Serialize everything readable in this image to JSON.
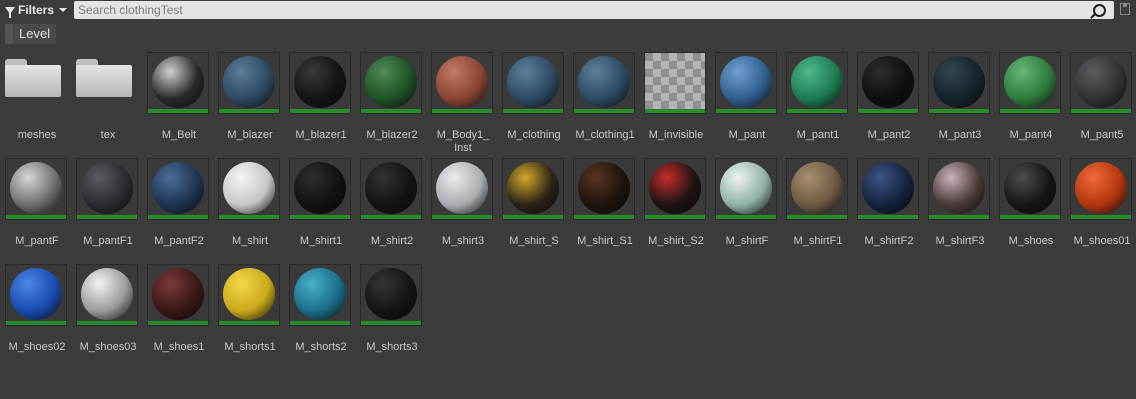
{
  "toolbar": {
    "filters_label": "Filters",
    "search_placeholder": "Search clothingTest"
  },
  "chips": {
    "level_label": "Level"
  },
  "assets": [
    {
      "label": "meshes",
      "kind": "folder"
    },
    {
      "label": "tex",
      "kind": "folder"
    },
    {
      "label": "M_Belt",
      "kind": "material",
      "color": "#2a2a2a",
      "highlight": "#cfcfcf"
    },
    {
      "label": "M_blazer",
      "kind": "material",
      "color": "#2e4a63",
      "highlight": "#5d7d98"
    },
    {
      "label": "M_blazer1",
      "kind": "material",
      "color": "#141414",
      "highlight": "#3a3a3a"
    },
    {
      "label": "M_blazer2",
      "kind": "material",
      "color": "#1f5226",
      "highlight": "#4f8a55"
    },
    {
      "label": "M_Body1_\nInst",
      "kind": "material",
      "color": "#8a4434",
      "highlight": "#c07a66"
    },
    {
      "label": "M_clothing",
      "kind": "material",
      "color": "#2d4a63",
      "highlight": "#5e7f9c"
    },
    {
      "label": "M_clothing1",
      "kind": "material",
      "color": "#2d4a63",
      "highlight": "#5e7f9c"
    },
    {
      "label": "M_invisible",
      "kind": "checker"
    },
    {
      "label": "M_pant",
      "kind": "material",
      "color": "#2f5f8e",
      "highlight": "#6f9fd0"
    },
    {
      "label": "M_pant1",
      "kind": "material",
      "color": "#1c7a55",
      "highlight": "#4fb88c"
    },
    {
      "label": "M_pant2",
      "kind": "material",
      "color": "#0f0f0f",
      "highlight": "#2e2e2e"
    },
    {
      "label": "M_pant3",
      "kind": "material",
      "color": "#15232b",
      "highlight": "#34464f"
    },
    {
      "label": "M_pant4",
      "kind": "material",
      "color": "#2f7a3e",
      "highlight": "#68b677"
    },
    {
      "label": "M_pant5",
      "kind": "material",
      "color": "#303234",
      "highlight": "#5b5e61"
    },
    {
      "label": "M_pantF",
      "kind": "material",
      "color": "#6e6e6e",
      "highlight": "#d6d6d6"
    },
    {
      "label": "M_pantF1",
      "kind": "material",
      "color": "#2a2c30",
      "highlight": "#5a5d63"
    },
    {
      "label": "M_pantF2",
      "kind": "material",
      "color": "#1e3452",
      "highlight": "#4d6e99"
    },
    {
      "label": "M_shirt",
      "kind": "material",
      "color": "#c6c6c6",
      "highlight": "#f4f4f4"
    },
    {
      "label": "M_shirt1",
      "kind": "material",
      "color": "#111111",
      "highlight": "#2f2f2f"
    },
    {
      "label": "M_shirt2",
      "kind": "material",
      "color": "#131313",
      "highlight": "#333333"
    },
    {
      "label": "M_shirt3",
      "kind": "material",
      "color": "#a9adb0",
      "highlight": "#e8eaec"
    },
    {
      "label": "M_shirt_S",
      "kind": "material",
      "color": "#2a2418",
      "highlight": "#d4a72a"
    },
    {
      "label": "M_shirt_S1",
      "kind": "material",
      "color": "#1e140e",
      "highlight": "#5a3522"
    },
    {
      "label": "M_shirt_S2",
      "kind": "material",
      "color": "#1c1414",
      "highlight": "#c52c2c"
    },
    {
      "label": "M_shirtF",
      "kind": "material",
      "color": "#8fb0a8",
      "highlight": "#eef3ee"
    },
    {
      "label": "M_shirtF1",
      "kind": "material",
      "color": "#6e5a43",
      "highlight": "#a88e6e"
    },
    {
      "label": "M_shirtF2",
      "kind": "material",
      "color": "#14233f",
      "highlight": "#3d5585"
    },
    {
      "label": "M_shirtF3",
      "kind": "material",
      "color": "#4a3a3a",
      "highlight": "#c9b2b6"
    },
    {
      "label": "M_shoes",
      "kind": "material",
      "color": "#161616",
      "highlight": "#4e4e4e"
    },
    {
      "label": "M_shoes01",
      "kind": "material",
      "color": "#b3360f",
      "highlight": "#f06a3a"
    },
    {
      "label": "M_shoes02",
      "kind": "material",
      "color": "#1a4bb0",
      "highlight": "#4d86e8"
    },
    {
      "label": "M_shoes03",
      "kind": "material",
      "color": "#9a9a9a",
      "highlight": "#f2f2f2"
    },
    {
      "label": "M_shoes1",
      "kind": "material",
      "color": "#3a1818",
      "highlight": "#7a3a3a"
    },
    {
      "label": "M_shorts1",
      "kind": "material",
      "color": "#c9a81a",
      "highlight": "#f2d84a"
    },
    {
      "label": "M_shorts2",
      "kind": "material",
      "color": "#1a6f8a",
      "highlight": "#4ab0cc"
    },
    {
      "label": "M_shorts3",
      "kind": "material",
      "color": "#141414",
      "highlight": "#363636"
    }
  ]
}
